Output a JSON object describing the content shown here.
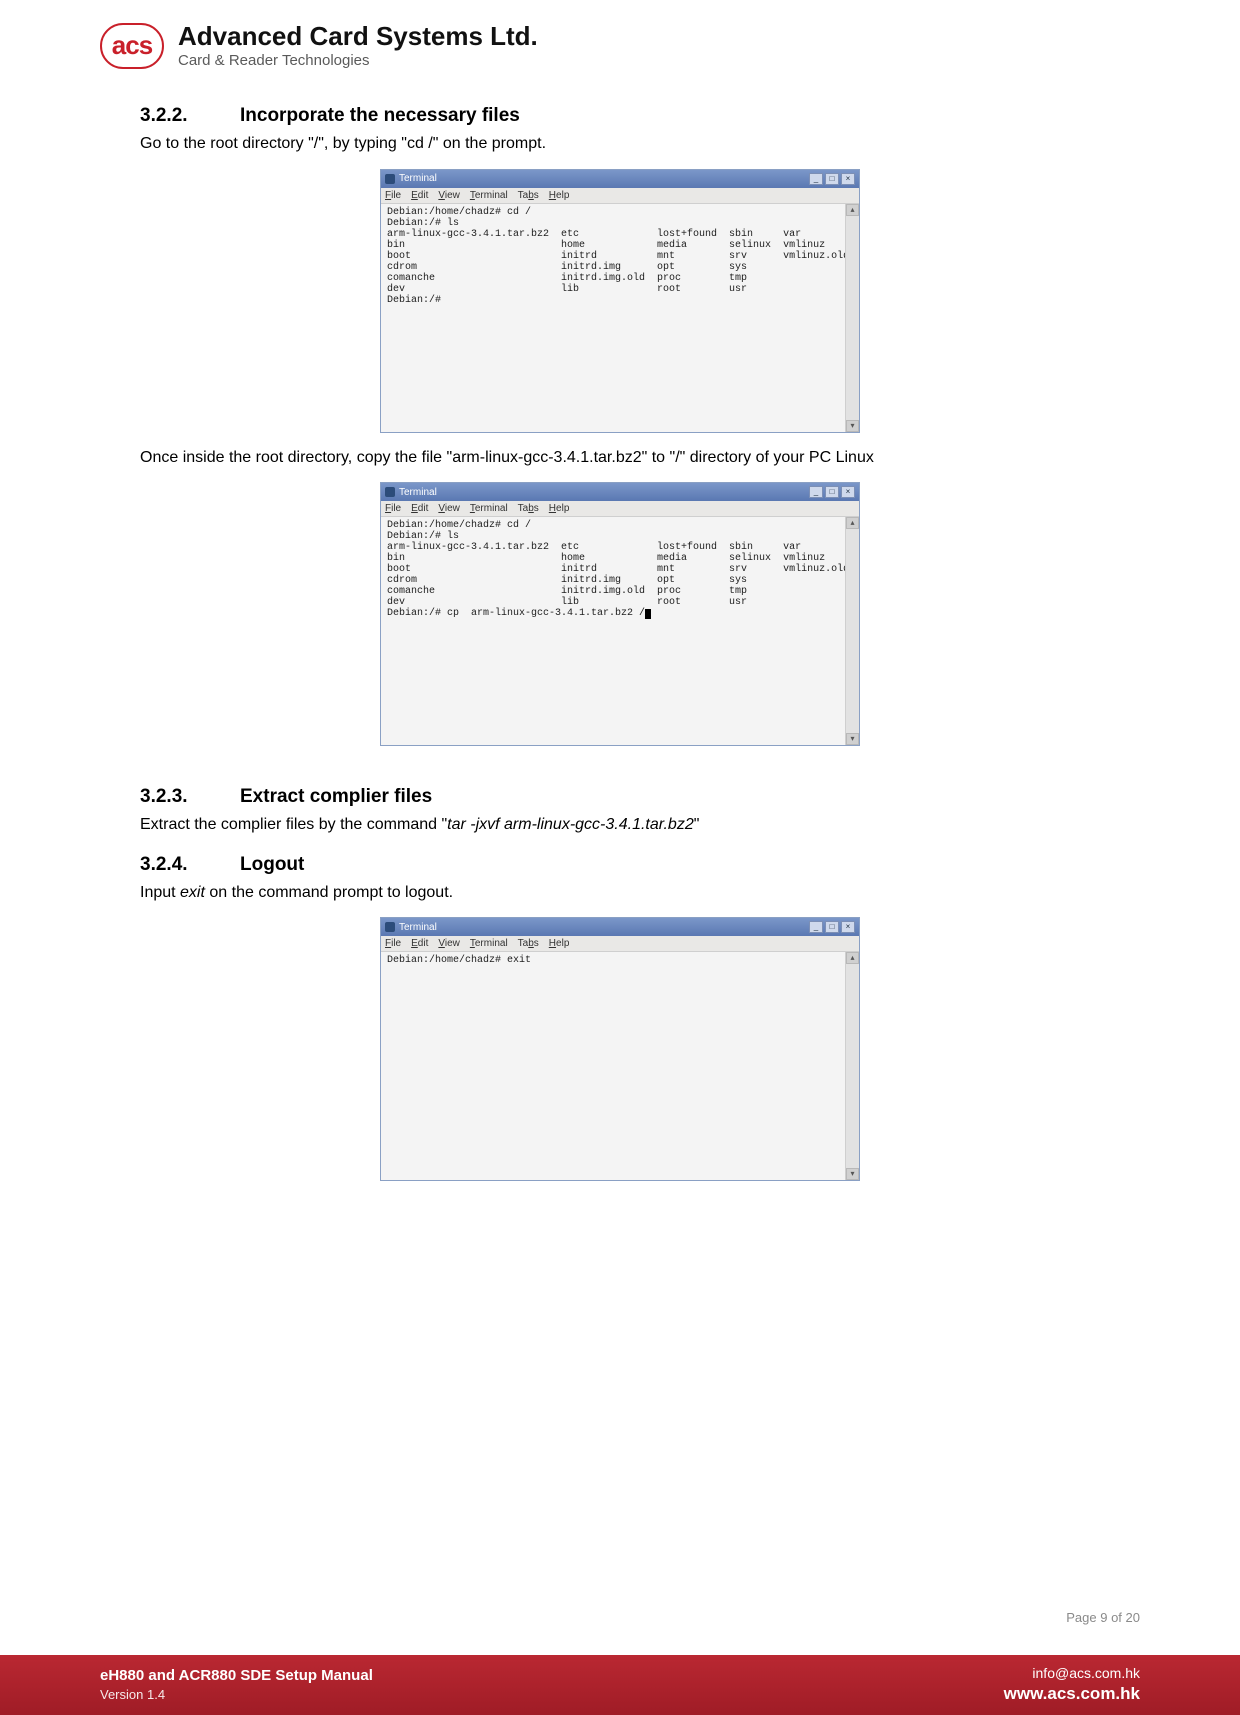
{
  "brand": {
    "logo_text": "acs",
    "company": "Advanced Card Systems Ltd.",
    "tagline": "Card & Reader Technologies"
  },
  "sections": {
    "s322": {
      "num": "3.2.2.",
      "title": "Incorporate the necessary files"
    },
    "s323": {
      "num": "3.2.3.",
      "title": "Extract complier files"
    },
    "s324": {
      "num": "3.2.4.",
      "title": "Logout"
    }
  },
  "paragraphs": {
    "p1": "Go to the root directory \"/\", by typing \"cd /\" on the prompt.",
    "p2": "Once inside the root directory, copy the file \"arm-linux-gcc-3.4.1.tar.bz2\" to \"/\" directory of your PC Linux",
    "p3_pre": "Extract the complier files by the command \"",
    "p3_cmd": "tar -jxvf arm-linux-gcc-3.4.1.tar.bz2",
    "p3_post": "\"",
    "p4_pre": "Input ",
    "p4_cmd": "exit",
    "p4_post": " on the command prompt to logout."
  },
  "terminal_common": {
    "title": "Terminal",
    "menu": [
      "File",
      "Edit",
      "View",
      "Terminal",
      "Tabs",
      "Help"
    ],
    "min": "_",
    "max": "□",
    "close": "×",
    "scroll_up": "▴",
    "scroll_down": "▾"
  },
  "terminal1": "Debian:/home/chadz# cd /\nDebian:/# ls\narm-linux-gcc-3.4.1.tar.bz2  etc             lost+found  sbin     var\nbin                          home            media       selinux  vmlinuz\nboot                         initrd          mnt         srv      vmlinuz.old\ncdrom                        initrd.img      opt         sys\ncomanche                     initrd.img.old  proc        tmp\ndev                          lib             root        usr\nDebian:/#",
  "terminal2": "Debian:/home/chadz# cd /\nDebian:/# ls\narm-linux-gcc-3.4.1.tar.bz2  etc             lost+found  sbin     var\nbin                          home            media       selinux  vmlinuz\nboot                         initrd          mnt         srv      vmlinuz.old\ncdrom                        initrd.img      opt         sys\ncomanche                     initrd.img.old  proc        tmp\ndev                          lib             root        usr\nDebian:/# cp  arm-linux-gcc-3.4.1.tar.bz2 /",
  "terminal3": "Debian:/home/chadz# exit",
  "page_number": "Page 9 of 20",
  "footer": {
    "title": "eH880 and ACR880 SDE Setup Manual",
    "version": "Version 1.4",
    "email": "info@acs.com.hk",
    "site": "www.acs.com.hk"
  }
}
